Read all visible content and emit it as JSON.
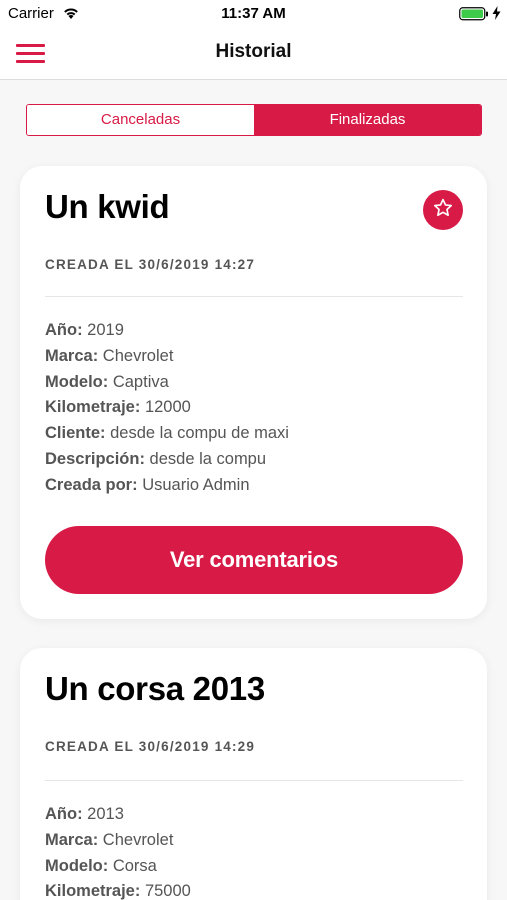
{
  "status_bar": {
    "carrier": "Carrier",
    "time": "11:37 AM"
  },
  "nav": {
    "title": "Historial",
    "menu_icon": "hamburger-menu-icon"
  },
  "tabs": [
    {
      "label": "Canceladas",
      "active": false
    },
    {
      "label": "Finalizadas",
      "active": true
    }
  ],
  "colors": {
    "accent": "#d81a46",
    "background": "#f7f7f7",
    "card": "#ffffff"
  },
  "cards": [
    {
      "title": "Un kwid",
      "date": "CREADA EL 30/6/2019 14:27",
      "fields": [
        {
          "label": "Año:",
          "value": "2019"
        },
        {
          "label": "Marca:",
          "value": "Chevrolet"
        },
        {
          "label": "Modelo:",
          "value": "Captiva"
        },
        {
          "label": "Kilometraje:",
          "value": "12000"
        },
        {
          "label": "Cliente:",
          "value": "desde la compu de maxi"
        },
        {
          "label": "Descripción:",
          "value": "desde la compu"
        },
        {
          "label": "Creada por:",
          "value": "Usuario Admin"
        }
      ],
      "button_label": "Ver comentarios",
      "favorite_icon": "star-icon"
    },
    {
      "title": "Un corsa 2013",
      "date": "CREADA EL 30/6/2019 14:29",
      "fields": [
        {
          "label": "Año:",
          "value": "2013"
        },
        {
          "label": "Marca:",
          "value": "Chevrolet"
        },
        {
          "label": "Modelo:",
          "value": "Corsa"
        },
        {
          "label": "Kilometraje:",
          "value": "75000"
        }
      ]
    }
  ]
}
